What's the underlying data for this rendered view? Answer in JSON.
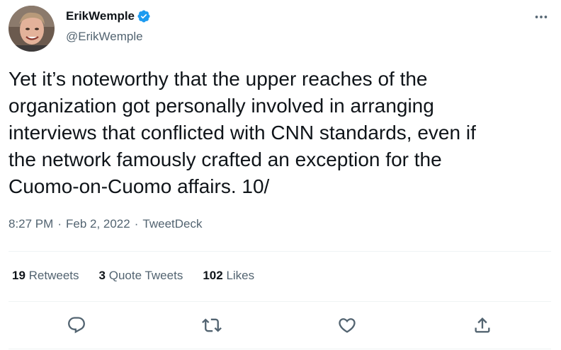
{
  "author": {
    "display_name": "ErikWemple",
    "handle": "@ErikWemple",
    "verified": true
  },
  "tweet": {
    "text": "Yet it’s noteworthy that the upper reaches of the\norganization got personally involved in arranging\ninterviews that conflicted with CNN standards, even if\nthe network famously crafted an exception for the\nCuomo-on-Cuomo affairs. 10/",
    "time": "8:27 PM",
    "date": "Feb 2, 2022",
    "source": "TweetDeck",
    "separator": "·"
  },
  "stats": {
    "retweets_count": "19",
    "retweets_label": "Retweets",
    "quotes_count": "3",
    "quotes_label": "Quote Tweets",
    "likes_count": "102",
    "likes_label": "Likes"
  },
  "icons": {
    "reply": "reply-icon",
    "retweet": "retweet-icon",
    "like": "heart-icon",
    "share": "share-icon",
    "more": "more-icon",
    "verified": "verified-badge-icon"
  },
  "colors": {
    "verified": "#1d9bf0",
    "secondary_text": "#536471",
    "primary_text": "#0f1419",
    "divider": "#eff3f4"
  }
}
